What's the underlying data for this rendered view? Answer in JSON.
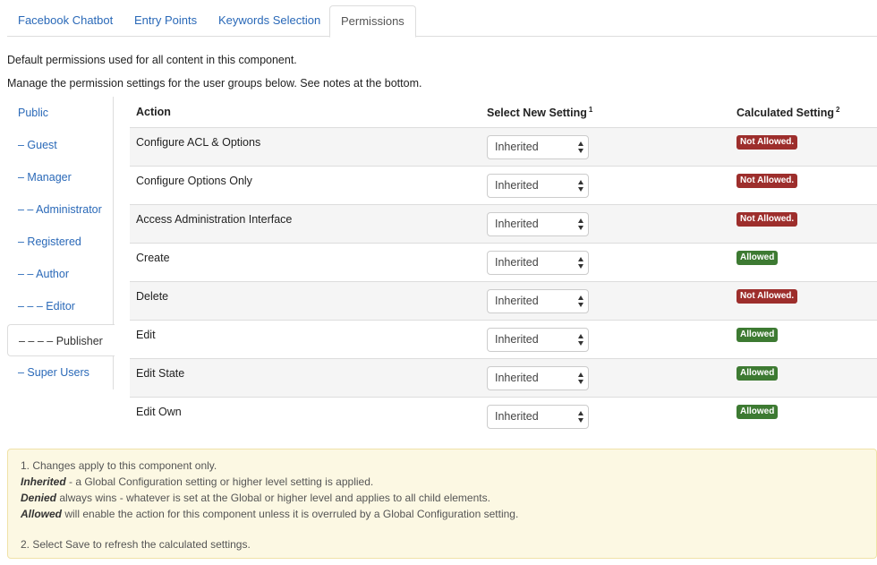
{
  "tabs": [
    {
      "label": "Facebook Chatbot",
      "active": false
    },
    {
      "label": "Entry Points",
      "active": false
    },
    {
      "label": "Keywords Selection",
      "active": false
    },
    {
      "label": "Permissions",
      "active": true
    }
  ],
  "intro": {
    "line1": "Default permissions used for all content in this component.",
    "line2": "Manage the permission settings for the user groups below. See notes at the bottom."
  },
  "groups": [
    {
      "label": "Public"
    },
    {
      "label": "– Guest"
    },
    {
      "label": "– Manager"
    },
    {
      "label": "– – Administrator"
    },
    {
      "label": "– Registered"
    },
    {
      "label": "– – Author"
    },
    {
      "label": "– – – Editor"
    },
    {
      "label": "– – – – Publisher",
      "active": true
    },
    {
      "label": "– Super Users"
    }
  ],
  "table": {
    "headers": {
      "action": "Action",
      "select": "Select New Setting",
      "select_note": "1",
      "calculated": "Calculated Setting",
      "calculated_note": "2"
    },
    "rows": [
      {
        "action": "Configure ACL & Options",
        "setting": "Inherited",
        "calculated": "Not Allowed."
      },
      {
        "action": "Configure Options Only",
        "setting": "Inherited",
        "calculated": "Not Allowed."
      },
      {
        "action": "Access Administration Interface",
        "setting": "Inherited",
        "calculated": "Not Allowed."
      },
      {
        "action": "Create",
        "setting": "Inherited",
        "calculated": "Allowed"
      },
      {
        "action": "Delete",
        "setting": "Inherited",
        "calculated": "Not Allowed."
      },
      {
        "action": "Edit",
        "setting": "Inherited",
        "calculated": "Allowed"
      },
      {
        "action": "Edit State",
        "setting": "Inherited",
        "calculated": "Allowed"
      },
      {
        "action": "Edit Own",
        "setting": "Inherited",
        "calculated": "Allowed"
      }
    ]
  },
  "notes": {
    "line1": "1. Changes apply to this component only.",
    "inherited_term": "Inherited",
    "inherited_text": " - a Global Configuration setting or higher level setting is applied.",
    "denied_term": "Denied",
    "denied_text": " always wins - whatever is set at the Global or higher level and applies to all child elements.",
    "allowed_term": "Allowed",
    "allowed_text": " will enable the action for this component unless it is overruled by a Global Configuration setting.",
    "line5": "2. Select Save to refresh the calculated settings."
  },
  "colors": {
    "link": "#2a69b8",
    "not_allowed": "#9d2e2c",
    "allowed": "#3d7a32",
    "notes_bg": "#fcf8e3"
  }
}
